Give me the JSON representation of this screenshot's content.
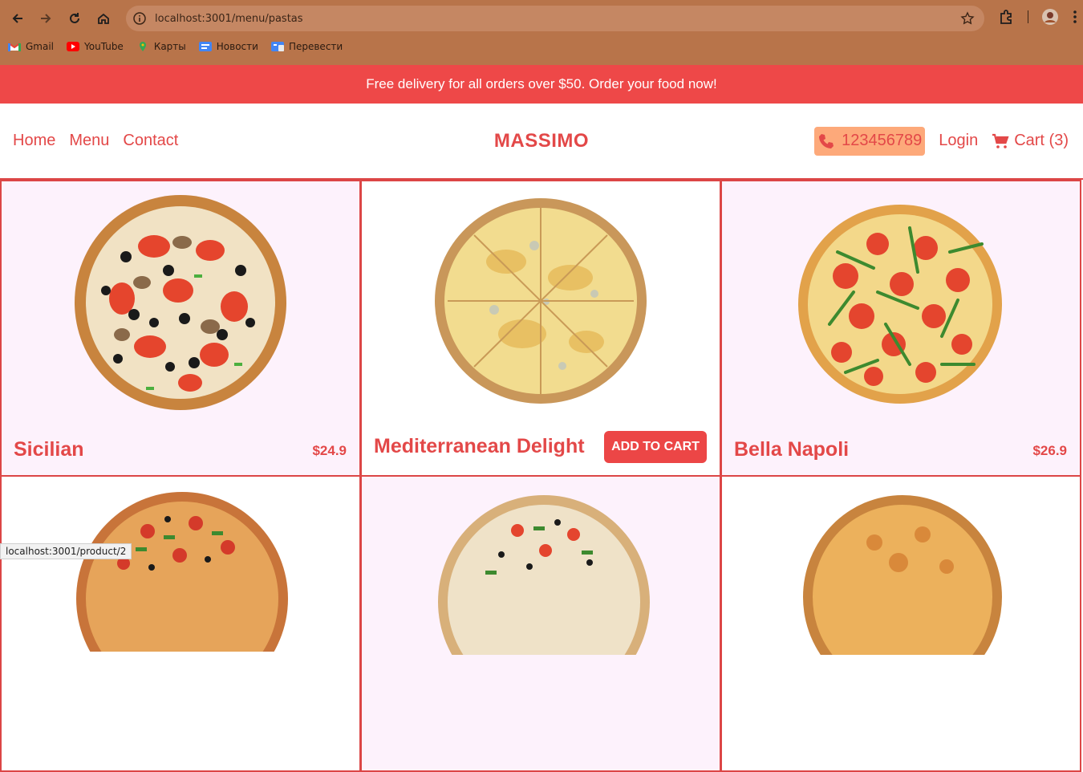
{
  "browser": {
    "url": "localhost:3001/menu/pastas",
    "bookmarks": [
      {
        "label": "Gmail",
        "icon": "gmail-icon"
      },
      {
        "label": "YouTube",
        "icon": "youtube-icon"
      },
      {
        "label": "Карты",
        "icon": "maps-icon"
      },
      {
        "label": "Новости",
        "icon": "news-icon"
      },
      {
        "label": "Перевести",
        "icon": "translate-icon"
      }
    ],
    "status_url": "localhost:3001/product/2"
  },
  "promo": {
    "text": "Free delivery for all orders over $50. Order your food now!"
  },
  "header": {
    "nav": [
      {
        "label": "Home"
      },
      {
        "label": "Menu"
      },
      {
        "label": "Contact"
      }
    ],
    "brand": "MASSIMO",
    "phone": "123456789",
    "login": "Login",
    "cart": "Cart (3)"
  },
  "products": [
    {
      "name": "Sicilian",
      "price": "$24.9"
    },
    {
      "name": "Mediterranean Delight",
      "button": "ADD TO CART"
    },
    {
      "name": "Bella Napoli",
      "price": "$26.9"
    }
  ],
  "colors": {
    "accent": "#e34848",
    "banner": "#ee4848",
    "phone_bg": "#fda97a",
    "card_pink": "#fdf2fc"
  }
}
